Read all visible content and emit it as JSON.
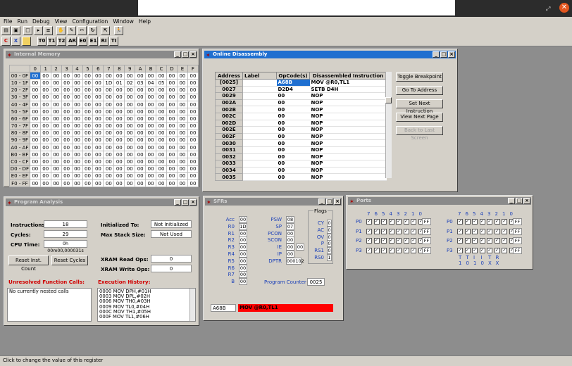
{
  "window_controls": {
    "restore": "⤢",
    "close": "✕"
  },
  "menu": [
    "File",
    "Run",
    "Debug",
    "View",
    "Configuration",
    "Window",
    "Help"
  ],
  "toolbar": {
    "row2": [
      "C",
      "X",
      "",
      "T0",
      "T1",
      "T2",
      "AR",
      "E0",
      "E1",
      "RI",
      "TI"
    ]
  },
  "internal_memory": {
    "title": "Internal Memory",
    "cols": [
      "0",
      "1",
      "2",
      "3",
      "4",
      "5",
      "6",
      "7",
      "8",
      "9",
      "A",
      "B",
      "C",
      "D",
      "E",
      "F"
    ],
    "rows": [
      {
        "label": "00 - 0F",
        "cells": [
          "00",
          "00",
          "00",
          "00",
          "00",
          "00",
          "00",
          "00",
          "00",
          "00",
          "00",
          "00",
          "00",
          "00",
          "00",
          "00"
        ]
      },
      {
        "label": "10 - 1F",
        "cells": [
          "00",
          "00",
          "00",
          "00",
          "00",
          "00",
          "00",
          "00",
          "01",
          "02",
          "03",
          "04",
          "05",
          "00",
          "00",
          "00"
        ]
      },
      {
        "label": "20 - 2F",
        "cells": [
          "00",
          "00",
          "00",
          "00",
          "00",
          "00",
          "00",
          "00",
          "00",
          "00",
          "00",
          "00",
          "00",
          "00",
          "00",
          "00"
        ]
      },
      {
        "label": "30 - 3F",
        "cells": [
          "00",
          "00",
          "00",
          "00",
          "00",
          "00",
          "00",
          "00",
          "00",
          "00",
          "00",
          "00",
          "00",
          "00",
          "00",
          "00"
        ]
      },
      {
        "label": "40 - 4F",
        "cells": [
          "00",
          "00",
          "00",
          "00",
          "00",
          "00",
          "00",
          "00",
          "00",
          "00",
          "00",
          "00",
          "00",
          "00",
          "00",
          "00"
        ]
      },
      {
        "label": "50 - 5F",
        "cells": [
          "00",
          "00",
          "00",
          "00",
          "00",
          "00",
          "00",
          "00",
          "00",
          "00",
          "00",
          "00",
          "00",
          "00",
          "00",
          "00"
        ]
      },
      {
        "label": "60 - 6F",
        "cells": [
          "00",
          "00",
          "00",
          "00",
          "00",
          "00",
          "00",
          "00",
          "00",
          "00",
          "00",
          "00",
          "00",
          "00",
          "00",
          "00"
        ]
      },
      {
        "label": "70 - 7F",
        "cells": [
          "00",
          "00",
          "00",
          "00",
          "00",
          "00",
          "00",
          "00",
          "00",
          "00",
          "00",
          "00",
          "00",
          "00",
          "00",
          "00"
        ]
      },
      {
        "label": "80 - 8F",
        "cells": [
          "00",
          "00",
          "00",
          "00",
          "00",
          "00",
          "00",
          "00",
          "00",
          "00",
          "00",
          "00",
          "00",
          "00",
          "00",
          "00"
        ]
      },
      {
        "label": "90 - 9F",
        "cells": [
          "00",
          "00",
          "00",
          "00",
          "00",
          "00",
          "00",
          "00",
          "00",
          "00",
          "00",
          "00",
          "00",
          "00",
          "00",
          "00"
        ]
      },
      {
        "label": "A0 - AF",
        "cells": [
          "00",
          "00",
          "00",
          "00",
          "00",
          "00",
          "00",
          "00",
          "00",
          "00",
          "00",
          "00",
          "00",
          "00",
          "00",
          "00"
        ]
      },
      {
        "label": "B0 - BF",
        "cells": [
          "00",
          "00",
          "00",
          "00",
          "00",
          "00",
          "00",
          "00",
          "00",
          "00",
          "00",
          "00",
          "00",
          "00",
          "00",
          "00"
        ]
      },
      {
        "label": "C0 - CF",
        "cells": [
          "00",
          "00",
          "00",
          "00",
          "00",
          "00",
          "00",
          "00",
          "00",
          "00",
          "00",
          "00",
          "00",
          "00",
          "00",
          "00"
        ]
      },
      {
        "label": "D0 - DF",
        "cells": [
          "00",
          "00",
          "00",
          "00",
          "00",
          "00",
          "00",
          "00",
          "00",
          "00",
          "00",
          "00",
          "00",
          "00",
          "00",
          "00"
        ]
      },
      {
        "label": "E0 - EF",
        "cells": [
          "00",
          "00",
          "00",
          "00",
          "00",
          "00",
          "00",
          "00",
          "00",
          "00",
          "00",
          "00",
          "00",
          "00",
          "00",
          "00"
        ]
      },
      {
        "label": "F0 - FF",
        "cells": [
          "00",
          "00",
          "00",
          "00",
          "00",
          "00",
          "00",
          "00",
          "00",
          "00",
          "00",
          "00",
          "00",
          "00",
          "00",
          "00"
        ]
      }
    ],
    "row_1_col_7": "1D"
  },
  "disassembly": {
    "title": "Online Disassembly",
    "headers": [
      "Address",
      "Label",
      "OpCode(s)",
      "Disassembled Instruction"
    ],
    "rows": [
      {
        "addr": "[0025]",
        "label": "",
        "op": "A68B",
        "ins": "MOV @R0,TL1"
      },
      {
        "addr": "0027",
        "label": "",
        "op": "D2D4",
        "ins": "SETB D4H"
      },
      {
        "addr": "0029",
        "label": "",
        "op": "00",
        "ins": "NOP"
      },
      {
        "addr": "002A",
        "label": "",
        "op": "00",
        "ins": "NOP"
      },
      {
        "addr": "002B",
        "label": "",
        "op": "00",
        "ins": "NOP"
      },
      {
        "addr": "002C",
        "label": "",
        "op": "00",
        "ins": "NOP"
      },
      {
        "addr": "002D",
        "label": "",
        "op": "00",
        "ins": "NOP"
      },
      {
        "addr": "002E",
        "label": "",
        "op": "00",
        "ins": "NOP"
      },
      {
        "addr": "002F",
        "label": "",
        "op": "00",
        "ins": "NOP"
      },
      {
        "addr": "0030",
        "label": "",
        "op": "00",
        "ins": "NOP"
      },
      {
        "addr": "0031",
        "label": "",
        "op": "00",
        "ins": "NOP"
      },
      {
        "addr": "0032",
        "label": "",
        "op": "00",
        "ins": "NOP"
      },
      {
        "addr": "0033",
        "label": "",
        "op": "00",
        "ins": "NOP"
      },
      {
        "addr": "0034",
        "label": "",
        "op": "00",
        "ins": "NOP"
      },
      {
        "addr": "0035",
        "label": "",
        "op": "00",
        "ins": "NOP"
      }
    ],
    "buttons": {
      "toggle": "Toggle Breakpoint",
      "goto": "Go To Address",
      "setnext": "Set Next Instruction",
      "viewnext": "View Next Page",
      "back": "Back to Last Screen"
    }
  },
  "program_analysis": {
    "title": "Program Analysis",
    "instructions_label": "Instructions:",
    "instructions": "18",
    "cycles_label": "Cycles:",
    "cycles": "29",
    "cpu_label": "CPU Time:",
    "cpu": "0h 00m00,000031s",
    "init_label": "Initialized To:",
    "init": "Not Initialized",
    "stack_label": "Max Stack Size:",
    "stack": "Not Used",
    "reset_inst": "Reset Inst. Count",
    "reset_cycles": "Reset Cycles",
    "xread_label": "XRAM Read Ops:",
    "xread": "0",
    "xwrite_label": "XRAM Write Ops:",
    "xwrite": "0",
    "unresolved_label": "Unresolved Function Calls:",
    "unresolved_text": "No currently nested calls",
    "history_label": "Execution History:",
    "history": [
      "0000 MOV DPH,#01H",
      "0003 MOV DPL,#02H",
      "0006 MOV TH0,#03H",
      "0009 MOV TL0,#04H",
      "000C MOV TH1,#05H",
      "000F MOV TL1,#06H"
    ]
  },
  "sfrs": {
    "title": "SFRs",
    "left": [
      {
        "n": "Acc",
        "v": "00"
      },
      {
        "n": "R0",
        "v": "1D"
      },
      {
        "n": "R1",
        "v": "00"
      },
      {
        "n": "R2",
        "v": "00"
      },
      {
        "n": "R3",
        "v": "00"
      },
      {
        "n": "R4",
        "v": "00"
      },
      {
        "n": "R5",
        "v": "00"
      },
      {
        "n": "R6",
        "v": "00"
      },
      {
        "n": "R7",
        "v": "00"
      },
      {
        "n": "B",
        "v": "00"
      }
    ],
    "mid": [
      {
        "n": "PSW",
        "v": "08"
      },
      {
        "n": "SP",
        "v": "07"
      },
      {
        "n": "PCON",
        "v": "00"
      },
      {
        "n": "SCON",
        "v": "00"
      },
      {
        "n": "IE",
        "v": "00",
        "v2": "00"
      },
      {
        "n": "IP",
        "v": "00"
      },
      {
        "n": "DPTR",
        "v": "000102"
      }
    ],
    "flags_label": "Flags",
    "flags": [
      {
        "n": "CY",
        "v": "0"
      },
      {
        "n": "AC",
        "v": "0"
      },
      {
        "n": "OV",
        "v": "0"
      },
      {
        "n": "P",
        "v": "0"
      },
      {
        "n": "RS1",
        "v": "0"
      },
      {
        "n": "RS0",
        "v": "1"
      }
    ],
    "pc_label": "Program Counter",
    "pc": "0025",
    "cur_op": "A68B",
    "cur_ins": "MOV @R0,TL1"
  },
  "ports": {
    "title": "Ports",
    "bits": [
      "7",
      "6",
      "5",
      "4",
      "3",
      "2",
      "1",
      "0"
    ],
    "names": [
      "P0",
      "P1",
      "P2",
      "P3"
    ],
    "val": "FF",
    "bottom_lines": [
      "T T I I T R",
      "1 0 1 0 X X"
    ]
  },
  "status": "Click to change the value of this register"
}
